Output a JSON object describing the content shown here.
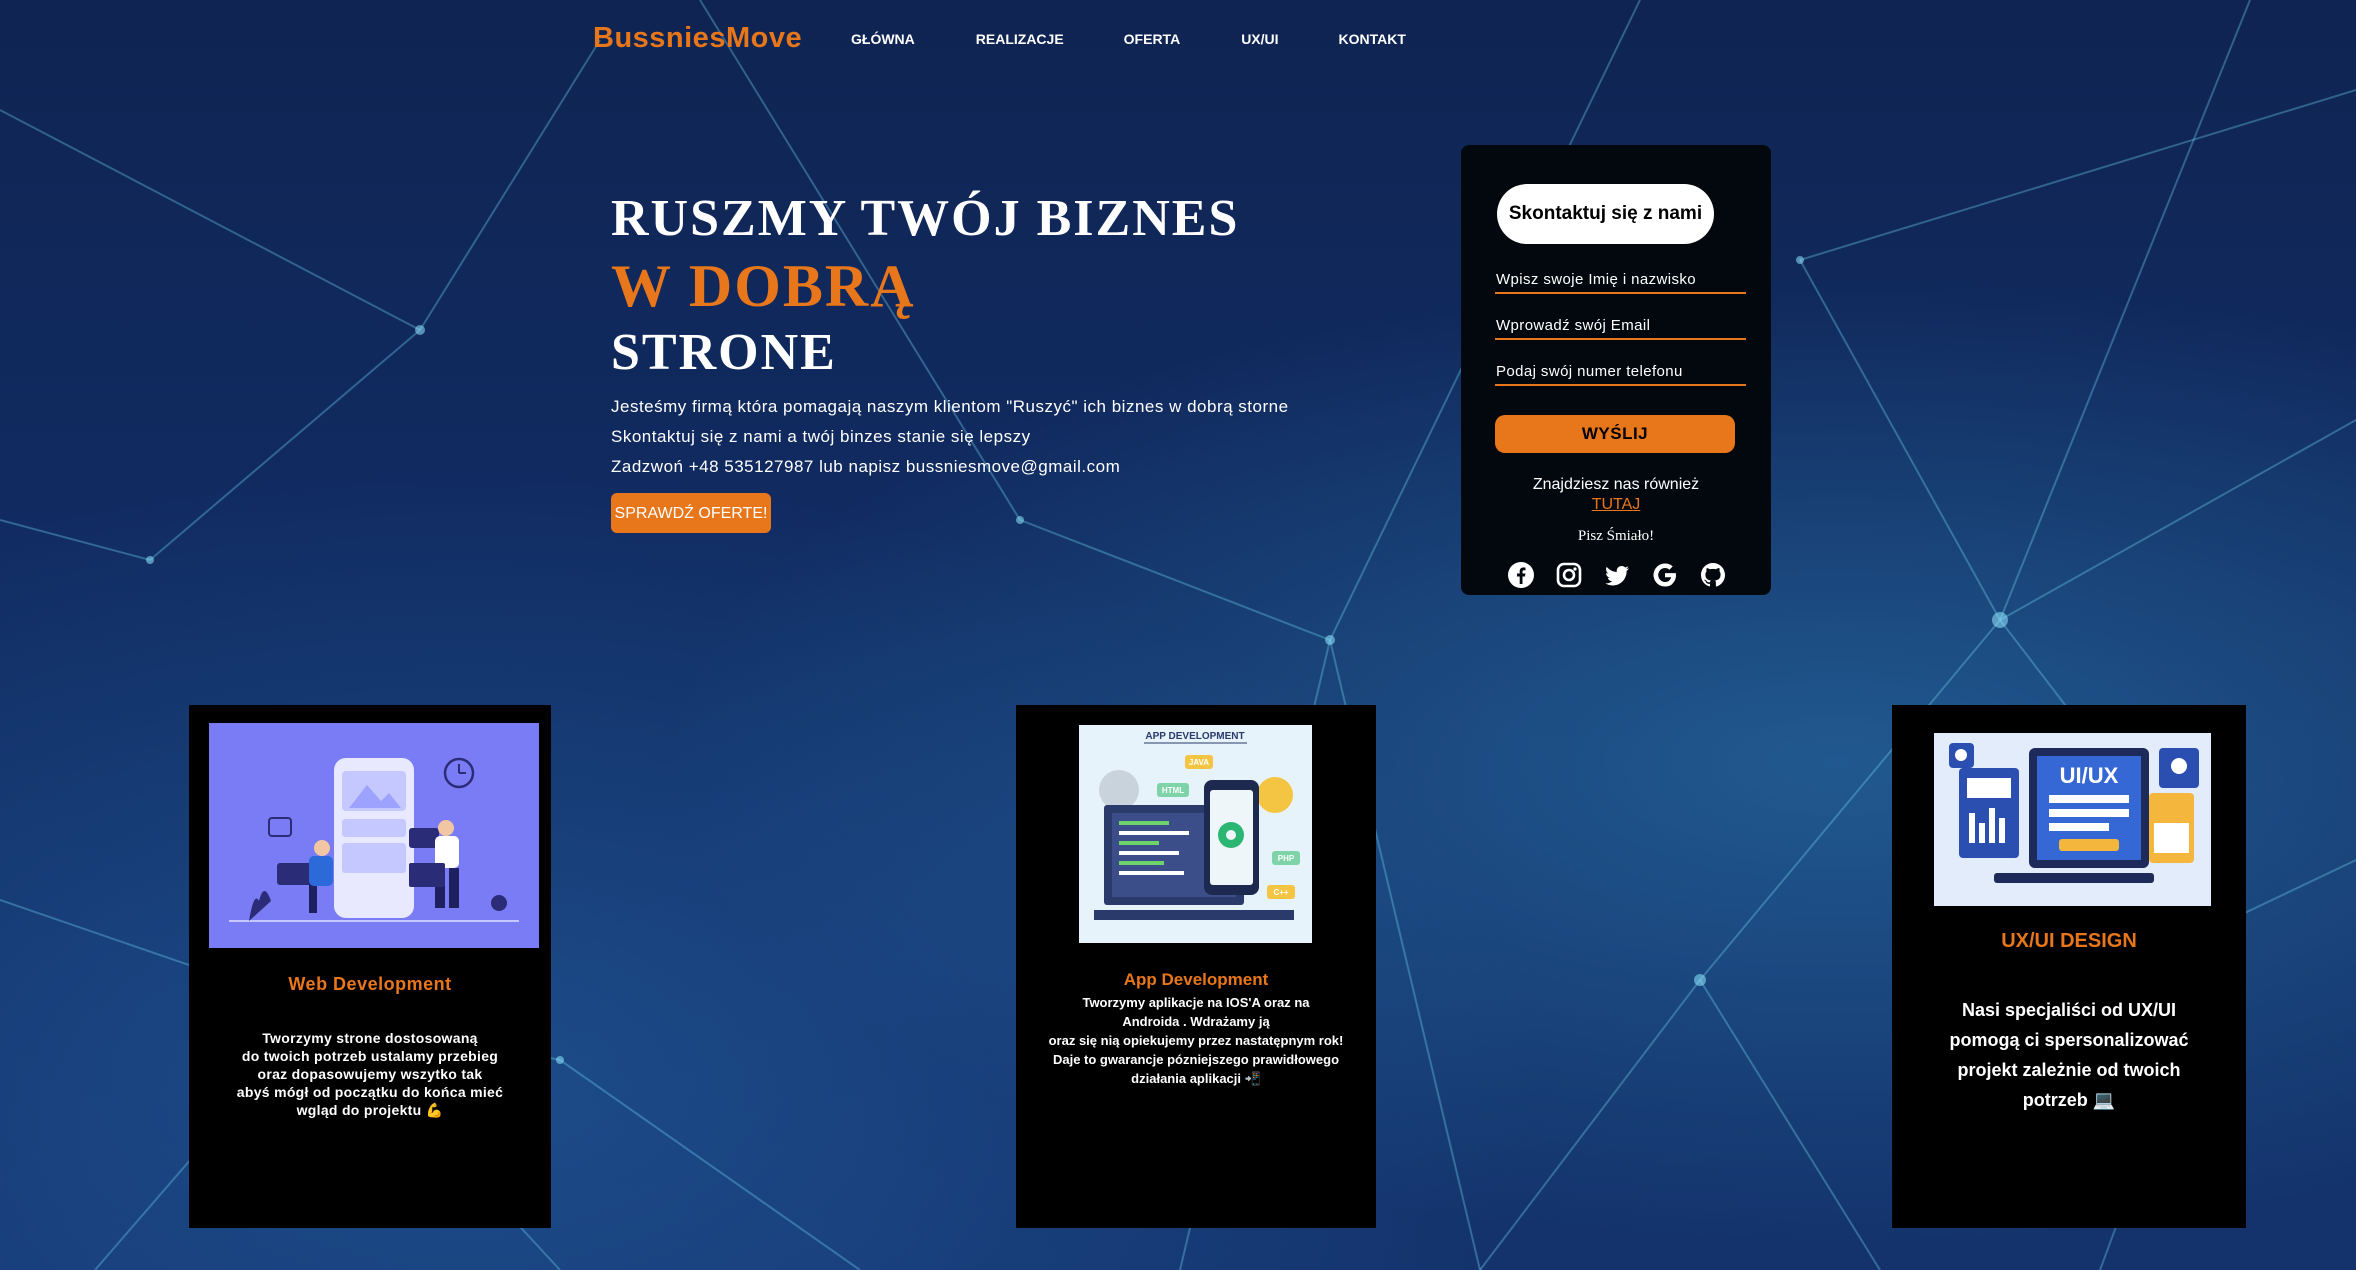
{
  "brand": {
    "logo": "BussniesMove",
    "accent": "#e8761a"
  },
  "nav": {
    "items": [
      {
        "label": "GŁÓWNA"
      },
      {
        "label": "REALIZACJE"
      },
      {
        "label": "OFERTA"
      },
      {
        "label": "UX/UI"
      },
      {
        "label": "KONTAKT"
      }
    ]
  },
  "hero": {
    "line1": "RUSZMY TWÓJ BIZNES",
    "line2": "W DOBRĄ",
    "line3": "STRONE",
    "p1": "Jesteśmy firmą która pomagają naszym klientom \"Ruszyć\" ich biznes w dobrą storne",
    "p2": "Skontaktuj się z nami a twój binzes stanie się lepszy",
    "p3": "Zadzwoń +48 535127987 lub napisz bussniesmove@gmail.com",
    "cta": "SPRAWDŹ OFERTE!"
  },
  "contact": {
    "title": "Skontaktuj się z nami",
    "name_placeholder": "Wpisz swoje Imię i nazwisko",
    "email_placeholder": "Wprowadź swój Email",
    "phone_placeholder": "Podaj swój numer telefonu",
    "send": "WYŚLIJ",
    "also": "Znajdziesz nas również",
    "also_link": "TUTAJ",
    "pisz": "Pisz Śmiało!",
    "social_icons": [
      "facebook-icon",
      "instagram-icon",
      "twitter-icon",
      "google-icon",
      "github-icon"
    ]
  },
  "cards": [
    {
      "title": "Web Development",
      "lines": [
        "Tworzymy strone dostosowaną",
        "do twoich potrzeb ustalamy przebieg",
        "oraz dopasowujemy wszytko tak",
        "abyś mógł od początku do końca mieć",
        "wgląd do projektu 💪"
      ]
    },
    {
      "title": "App Development",
      "img_title": "APP DEVELOPMENT",
      "img_tags": [
        "JAVA",
        "HTML",
        "PHP",
        "C++"
      ],
      "lines": [
        "Tworzymy aplikacje  na IOS'A oraz na",
        "Androida . Wdrażamy ją",
        "oraz się nią opiekujemy przez nastatępnym rok!",
        "Daje to gwarancje pózniejszego  prawidłowego",
        "działania aplikacji 📲"
      ]
    },
    {
      "title": "UX/UI DESIGN",
      "img_title": "UI/UX",
      "lines": [
        "Nasi specjaliści od UX/UI",
        "pomogą ci spersonalizować",
        "projekt zależnie od twoich",
        "potrzeb 💻"
      ]
    }
  ]
}
